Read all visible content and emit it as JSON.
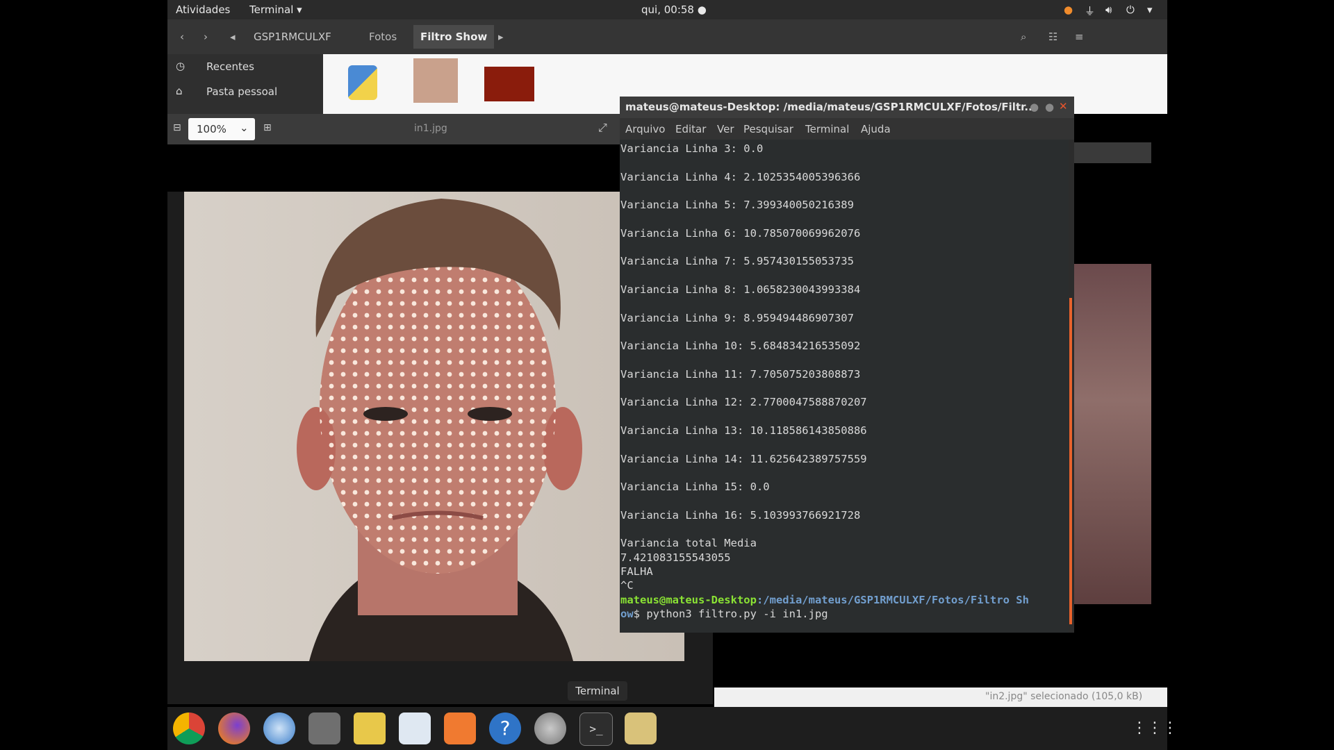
{
  "topbar": {
    "activities": "Atividades",
    "app_menu": "Terminal ▾",
    "clock": "qui, 00:58 ●"
  },
  "files": {
    "breadcrumb": [
      "GSP1RMCULXF",
      "Fotos",
      "Filtro Show"
    ],
    "sidebar": [
      "Recentes",
      "Pasta pessoal"
    ]
  },
  "viewer": {
    "zoom": "100%",
    "filename": "in1.jpg"
  },
  "terminal": {
    "title": "mateus@mateus-Desktop: /media/mateus/GSP1RMCULXF/Fotos/Filtr...",
    "menu": [
      "Arquivo",
      "Editar",
      "Ver",
      "Pesquisar",
      "Terminal",
      "Ajuda"
    ],
    "lines": [
      "Variancia Linha 3: 0.0",
      "",
      "Variancia Linha 4: 2.1025354005396366",
      "",
      "Variancia Linha 5: 7.399340050216389",
      "",
      "Variancia Linha 6: 10.785070069962076",
      "",
      "Variancia Linha 7: 5.957430155053735",
      "",
      "Variancia Linha 8: 1.0658230043993384",
      "",
      "Variancia Linha 9: 8.959494486907307",
      "",
      "Variancia Linha 10: 5.684834216535092",
      "",
      "Variancia Linha 11: 7.705075203808873",
      "",
      "Variancia Linha 12: 2.7700047588870207",
      "",
      "Variancia Linha 13: 10.118586143850886",
      "",
      "Variancia Linha 14: 11.625642389757559",
      "",
      "Variancia Linha 15: 0.0",
      "",
      "Variancia Linha 16: 5.103993766921728",
      "",
      "Variancia total Media",
      "7.421083155543055",
      "FALHA",
      "^C"
    ],
    "prompt_user": "mateus@mateus-Desktop",
    "prompt_path": ":/media/mateus/GSP1RMCULXF/Fotos/Filtro Sh",
    "prompt_path2": "ow",
    "command": "$ python3 filtro.py -i in1.jpg"
  },
  "status_selected": "\"in2.jpg\" selecionado (105,0 kB)",
  "tooltip": "Terminal",
  "dock_icons": [
    "chrome-icon",
    "firefox-icon",
    "thunderbird-icon",
    "files-icon",
    "rhythmbox-icon",
    "writer-icon",
    "software-icon",
    "help-icon",
    "settings-icon",
    "terminal-icon",
    "photos-icon"
  ]
}
